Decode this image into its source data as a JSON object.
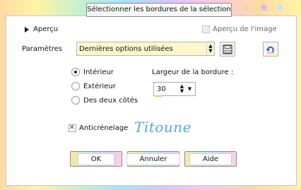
{
  "window": {
    "title": "Sélectionner les bordures de la sélection"
  },
  "preview": {
    "toggle_label": "Aperçu",
    "image_preview_label": "Aperçu de l'image",
    "image_preview_checked": false
  },
  "params": {
    "label": "Paramètres",
    "preset_value": "Dernières options utilisées"
  },
  "location": {
    "options": [
      {
        "label": "Intérieur",
        "selected": true
      },
      {
        "label": "Extérieur",
        "selected": false
      },
      {
        "label": "Des deux côtés",
        "selected": false
      }
    ]
  },
  "border": {
    "width_label": "Largeur de la bordure :",
    "width_value": "30"
  },
  "antialias": {
    "label": "Anticrénelage",
    "checked": true
  },
  "watermark": {
    "text": "Titoune"
  },
  "buttons": {
    "ok": "OK",
    "cancel": "Annuler",
    "help": "Aide"
  },
  "colors": {
    "accent_yellow": "#fff7cc",
    "signature_blue": "#5aa8d8"
  },
  "icons": [
    "moon-icon",
    "star-icon",
    "star-icon",
    "expand-arrow-icon",
    "save-preset-icon",
    "reset-icon"
  ]
}
